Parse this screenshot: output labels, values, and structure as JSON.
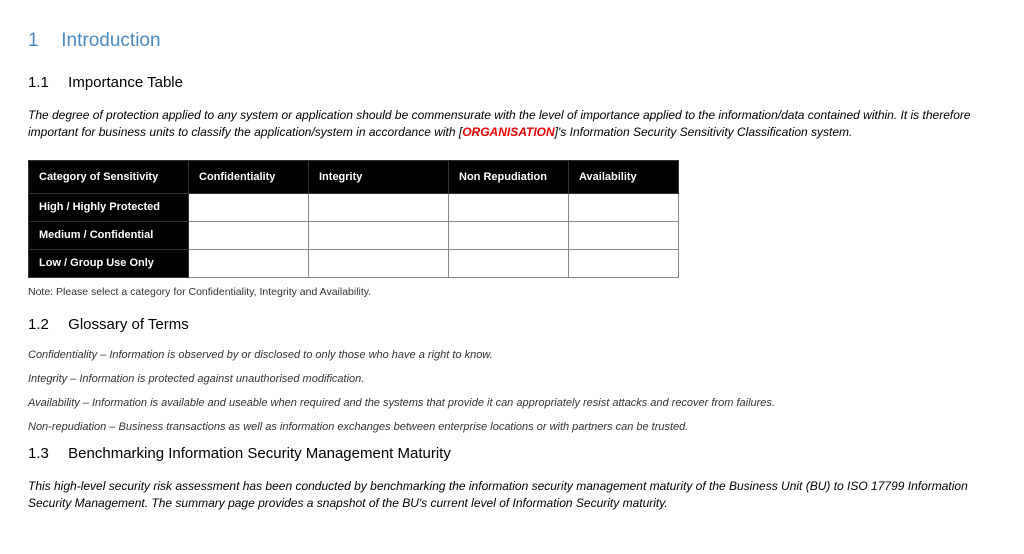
{
  "section1": {
    "number": "1",
    "title": "Introduction"
  },
  "section11": {
    "number": "1.1",
    "title": "Importance Table",
    "intro_pre": "The degree of protection applied to any system or application should be commensurate with the level of importance applied to the information/data contained within.  It is therefore important for business units to classify the application/system in accordance with [",
    "org_placeholder": "ORGANISATION",
    "intro_post": "]'s Information Security Sensitivity Classification system.",
    "table": {
      "headers": [
        "Category of Sensitivity",
        "Confidentiality",
        "Integrity",
        "Non Repudiation",
        "Availability"
      ],
      "rows": [
        {
          "label": "High / Highly Protected",
          "cells": [
            "",
            "",
            "",
            ""
          ]
        },
        {
          "label": "Medium / Confidential",
          "cells": [
            "",
            "",
            "",
            ""
          ]
        },
        {
          "label": "Low / Group Use Only",
          "cells": [
            "",
            "",
            "",
            ""
          ]
        }
      ]
    },
    "note": "Note:  Please select a category for Confidentiality, Integrity and Availability."
  },
  "section12": {
    "number": "1.2",
    "title": "Glossary of Terms",
    "items": [
      "Confidentiality – Information is observed by or disclosed to only those who have a right to know.",
      "Integrity – Information is protected against unauthorised modification.",
      "Availability – Information is available and useable when required and the systems that provide it can appropriately resist attacks and recover from failures.",
      "Non-repudiation – Business transactions as well as information exchanges between enterprise locations or with partners can be trusted."
    ]
  },
  "section13": {
    "number": "1.3",
    "title": "Benchmarking Information Security Management Maturity",
    "para": "This high-level security risk assessment has been conducted by benchmarking the information security management maturity of the Business Unit (BU) to ISO 17799 Information Security Management.  The summary page provides a snapshot of the BU's current level of Information Security maturity."
  }
}
